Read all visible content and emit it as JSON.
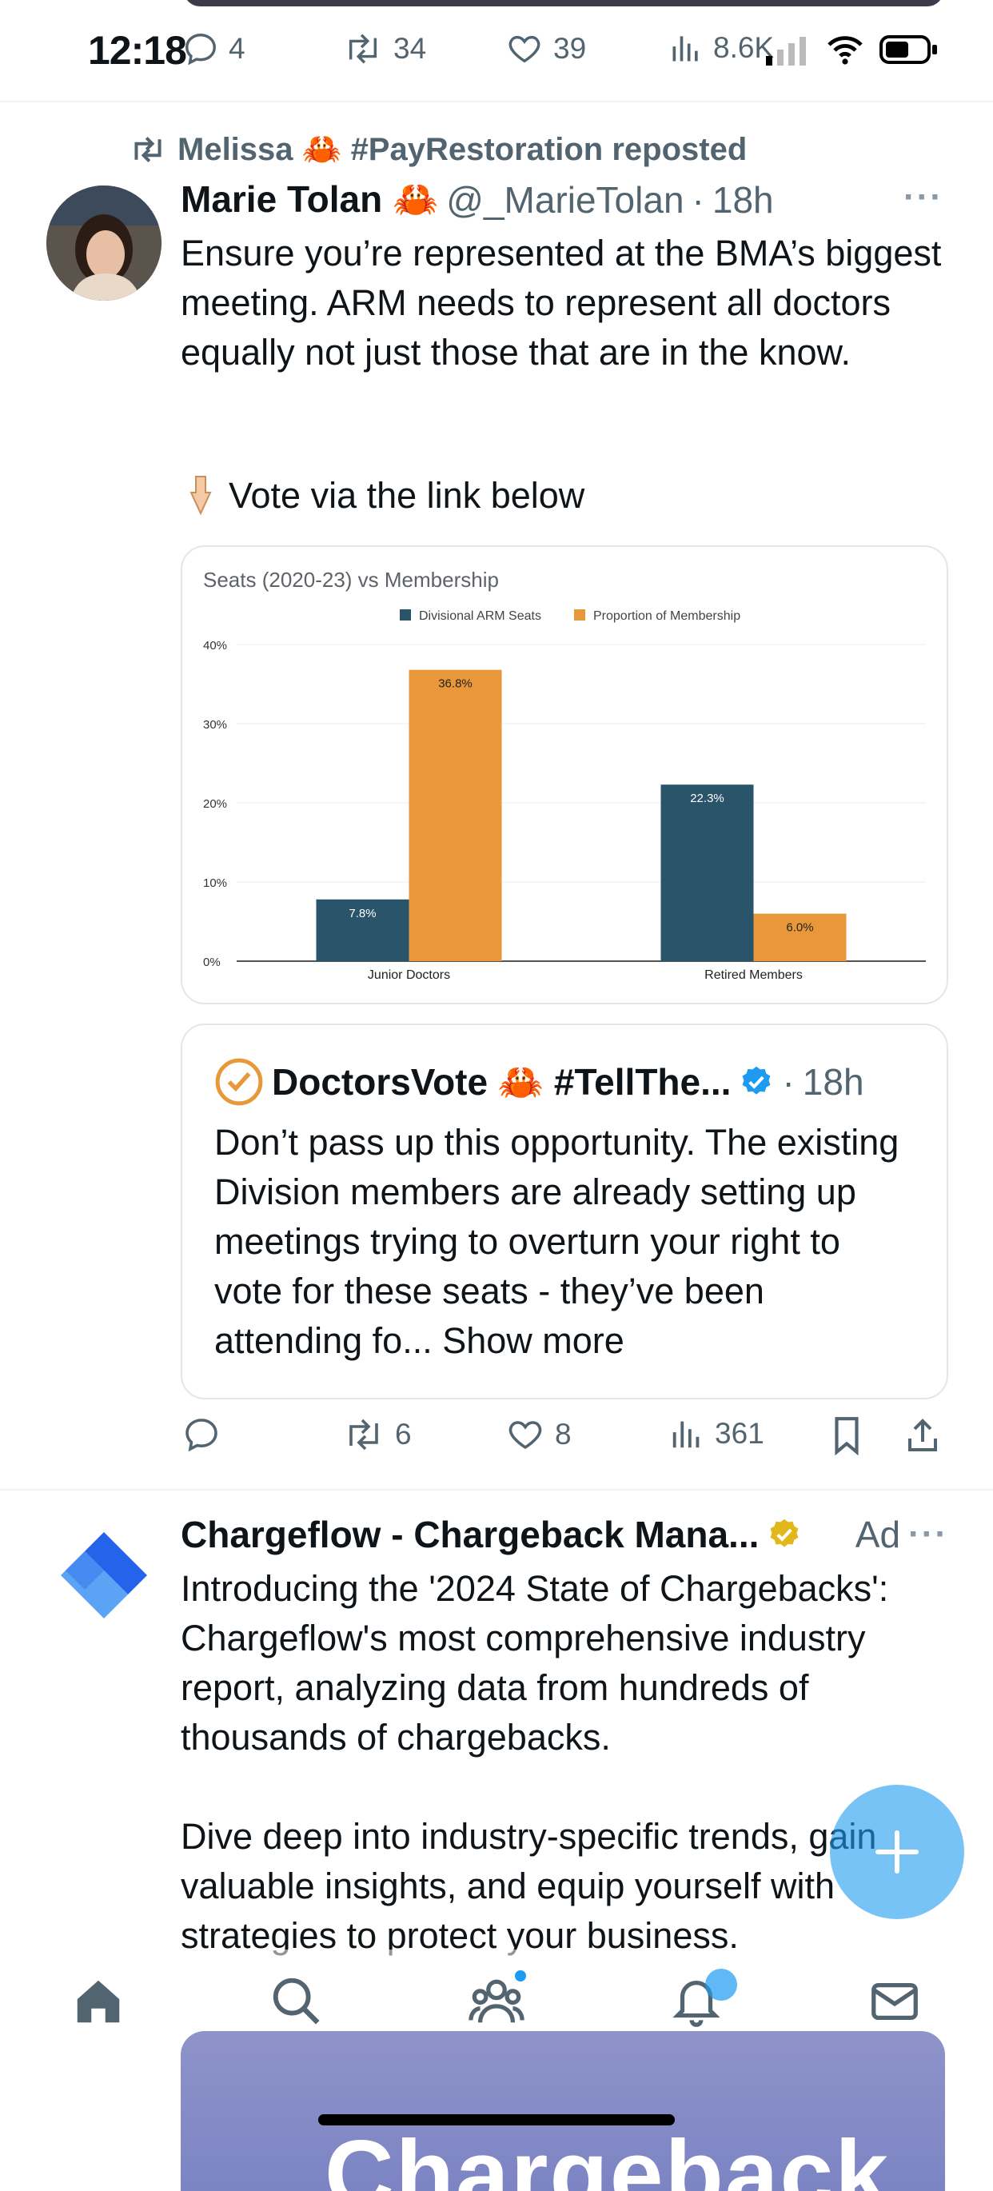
{
  "status_bar": {
    "time": "12:18"
  },
  "previous_tweet_actions": {
    "replies": "4",
    "reposts": "34",
    "likes": "39",
    "views": "8.6K"
  },
  "repost_attribution": "Melissa 🦀 #PayRestoration reposted",
  "tweet": {
    "author_name": "Marie Tolan 🦀",
    "handle": "@_MarieTolan",
    "time": "18h",
    "text": "Ensure you’re represented at the BMA’s biggest meeting. ARM needs to represent all doctors equally not just those that are in the know.",
    "vote_line": "Vote via the link below",
    "actions": {
      "replies": "",
      "reposts": "6",
      "likes": "8",
      "views": "361"
    }
  },
  "quote_tweet": {
    "author_name": "DoctorsVote 🦀 #TellThe...",
    "time": "18h",
    "text": "Don’t pass up this opportunity. The existing Division members are already setting up meetings trying to overturn your right to vote for these seats - they’ve been attending fo...",
    "show_more": "Show more"
  },
  "ad": {
    "author_name": "Chargeflow - Chargeback Mana...",
    "label": "Ad",
    "paragraph1": "Introducing the '2024 State of Chargebacks': Chargeflow's most comprehensive industry report, analyzing data from hundreds of thousands of chargebacks.",
    "paragraph2": "Dive deep into industry-specific trends, gain valuable insights, and equip yourself with strategies to protect your business.",
    "banner_text": "Chargeback"
  },
  "colors": {
    "accent": "#1d9bf0",
    "series_arm": "#2a5469",
    "series_membership": "#e8973a"
  },
  "chart_data": {
    "type": "bar",
    "title": "Seats (2020-23) vs Membership",
    "categories": [
      "Junior Doctors",
      "Retired Members"
    ],
    "series": [
      {
        "name": "Divisional ARM Seats",
        "values": [
          7.8,
          22.3
        ],
        "labels": [
          "7.8%",
          "22.3%"
        ]
      },
      {
        "name": "Proportion of Membership",
        "values": [
          36.8,
          6.0
        ],
        "labels": [
          "36.8%",
          "6.0%"
        ]
      }
    ],
    "y_ticks": [
      "0%",
      "10%",
      "20%",
      "30%",
      "40%"
    ],
    "ylim": [
      0,
      40
    ],
    "grid": true,
    "legend_position": "top"
  }
}
